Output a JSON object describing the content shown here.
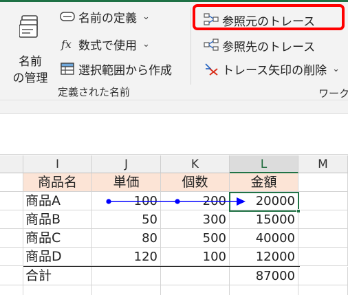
{
  "ribbon": {
    "name_manager": {
      "line1": "名前",
      "line2": "の管理",
      "icon": "name-manager-icon"
    },
    "define_name": {
      "label": "名前の定義",
      "icon": "define-name-icon",
      "chevron": "⌄"
    },
    "use_in_formula": {
      "label": "数式で使用",
      "icon": "function-icon",
      "chevron": "⌄"
    },
    "create_from_selection": {
      "label": "選択範囲から作成",
      "icon": "create-from-selection-icon"
    },
    "group_defined_names": "定義された名前",
    "trace_precedents": {
      "label": "参照元のトレース",
      "icon": "trace-precedents-icon"
    },
    "trace_dependents": {
      "label": "参照先のトレース",
      "icon": "trace-dependents-icon"
    },
    "remove_arrows": {
      "label": "トレース矢印の削除",
      "icon": "remove-arrows-icon",
      "chevron": "⌄"
    },
    "group_workbook_partial": "ワーク"
  },
  "highlight_color": "#ff0000",
  "accent_color": "#217346",
  "trace_arrow_color": "#0000ff",
  "grid": {
    "columns": [
      "I",
      "J",
      "K",
      "L",
      "M"
    ],
    "selected_column": "L",
    "header_row": [
      "商品名",
      "単価",
      "個数",
      "金額"
    ],
    "rows": [
      [
        "商品A",
        "100",
        "200",
        "20000"
      ],
      [
        "商品B",
        "50",
        "300",
        "15000"
      ],
      [
        "商品C",
        "80",
        "500",
        "40000"
      ],
      [
        "商品D",
        "120",
        "100",
        "12000"
      ],
      [
        "合計",
        "",
        "",
        "87000"
      ]
    ],
    "active_cell": "L (商品A 金額)"
  }
}
